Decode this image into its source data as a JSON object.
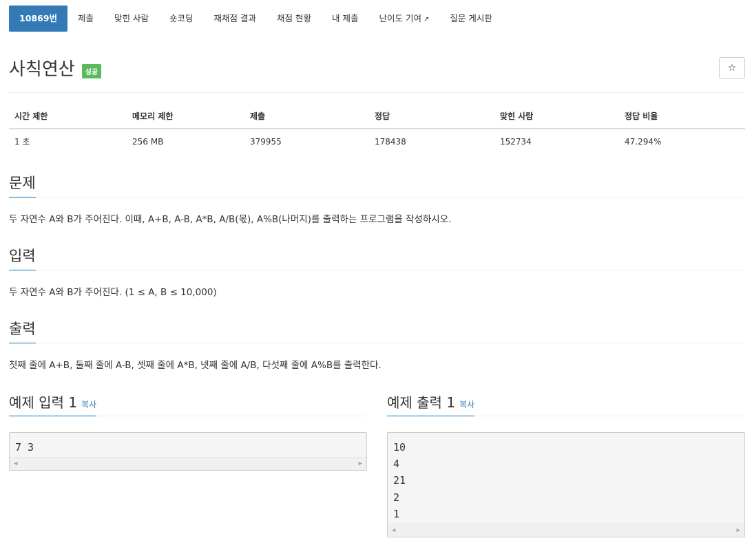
{
  "nav": {
    "items": [
      {
        "label": "10869번",
        "active": true
      },
      {
        "label": "제출"
      },
      {
        "label": "맞힌 사람"
      },
      {
        "label": "숏코딩"
      },
      {
        "label": "재채점 결과"
      },
      {
        "label": "채점 현황"
      },
      {
        "label": "내 제출"
      },
      {
        "label": "난이도 기여"
      },
      {
        "label": "질문 게시판"
      }
    ]
  },
  "problem": {
    "title": "사칙연산",
    "badge": "성공",
    "star": "☆"
  },
  "info": {
    "headers": [
      "시간 제한",
      "메모리 제한",
      "제출",
      "정답",
      "맞힌 사람",
      "정답 비율"
    ],
    "values": [
      "1 초",
      "256 MB",
      "379955",
      "178438",
      "152734",
      "47.294%"
    ]
  },
  "sections": {
    "problem_head": "문제",
    "problem_text": "두 자연수 A와 B가 주어진다. 이때, A+B, A-B, A*B, A/B(몫), A%B(나머지)를 출력하는 프로그램을 작성하시오.",
    "input_head": "입력",
    "input_text": "두 자연수 A와 B가 주어진다. (1 ≤ A, B ≤ 10,000)",
    "output_head": "출력",
    "output_text": "첫째 줄에 A+B, 둘째 줄에 A-B, 셋째 줄에 A*B, 넷째 줄에 A/B, 다섯째 줄에 A%B를 출력한다."
  },
  "samples": {
    "input_title": "예제 입력 1",
    "output_title": "예제 출력 1",
    "copy_label": "복사",
    "input_lines": [
      "7 3"
    ],
    "output_lines": [
      "10",
      "4",
      "21",
      "2",
      "1"
    ]
  }
}
